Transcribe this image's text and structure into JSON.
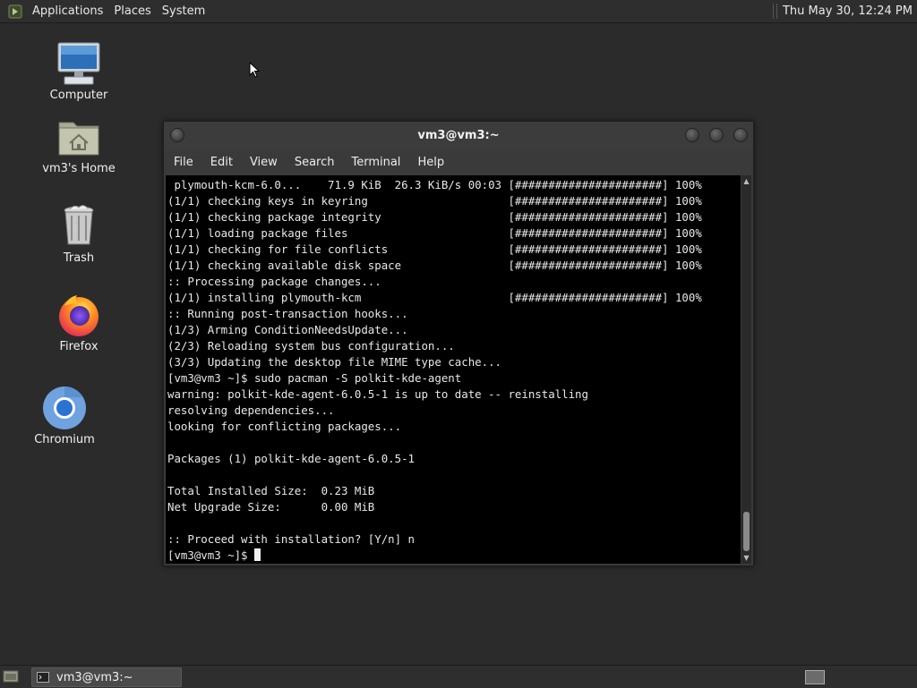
{
  "top_panel": {
    "menus": [
      "Applications",
      "Places",
      "System"
    ],
    "clock": "Thu May 30, 12:24 PM"
  },
  "desktop_icons": [
    {
      "label": "Computer",
      "icon": "computer-icon"
    },
    {
      "label": "vm3's Home",
      "icon": "home-folder-icon"
    },
    {
      "label": "Trash",
      "icon": "trash-icon"
    },
    {
      "label": "Firefox",
      "icon": "firefox-icon"
    },
    {
      "label": "Chromium",
      "icon": "chromium-icon"
    }
  ],
  "terminal": {
    "title": "vm3@vm3:~",
    "menu": [
      "File",
      "Edit",
      "View",
      "Search",
      "Terminal",
      "Help"
    ],
    "lines": [
      " plymouth-kcm-6.0...    71.9 KiB  26.3 KiB/s 00:03 [######################] 100%",
      "(1/1) checking keys in keyring                     [######################] 100%",
      "(1/1) checking package integrity                   [######################] 100%",
      "(1/1) loading package files                        [######################] 100%",
      "(1/1) checking for file conflicts                  [######################] 100%",
      "(1/1) checking available disk space                [######################] 100%",
      ":: Processing package changes...",
      "(1/1) installing plymouth-kcm                      [######################] 100%",
      ":: Running post-transaction hooks...",
      "(1/3) Arming ConditionNeedsUpdate...",
      "(2/3) Reloading system bus configuration...",
      "(3/3) Updating the desktop file MIME type cache...",
      "[vm3@vm3 ~]$ sudo pacman -S polkit-kde-agent",
      "warning: polkit-kde-agent-6.0.5-1 is up to date -- reinstalling",
      "resolving dependencies...",
      "looking for conflicting packages...",
      "",
      "Packages (1) polkit-kde-agent-6.0.5-1",
      "",
      "Total Installed Size:  0.23 MiB",
      "Net Upgrade Size:      0.00 MiB",
      "",
      ":: Proceed with installation? [Y/n] n"
    ],
    "prompt": "[vm3@vm3 ~]$ "
  },
  "taskbar": {
    "window_button": "vm3@vm3:~"
  },
  "colors": {
    "desktop_bg": "#2b2b2b",
    "terminal_bg": "#000000",
    "terminal_fg": "#e8e8e8"
  }
}
